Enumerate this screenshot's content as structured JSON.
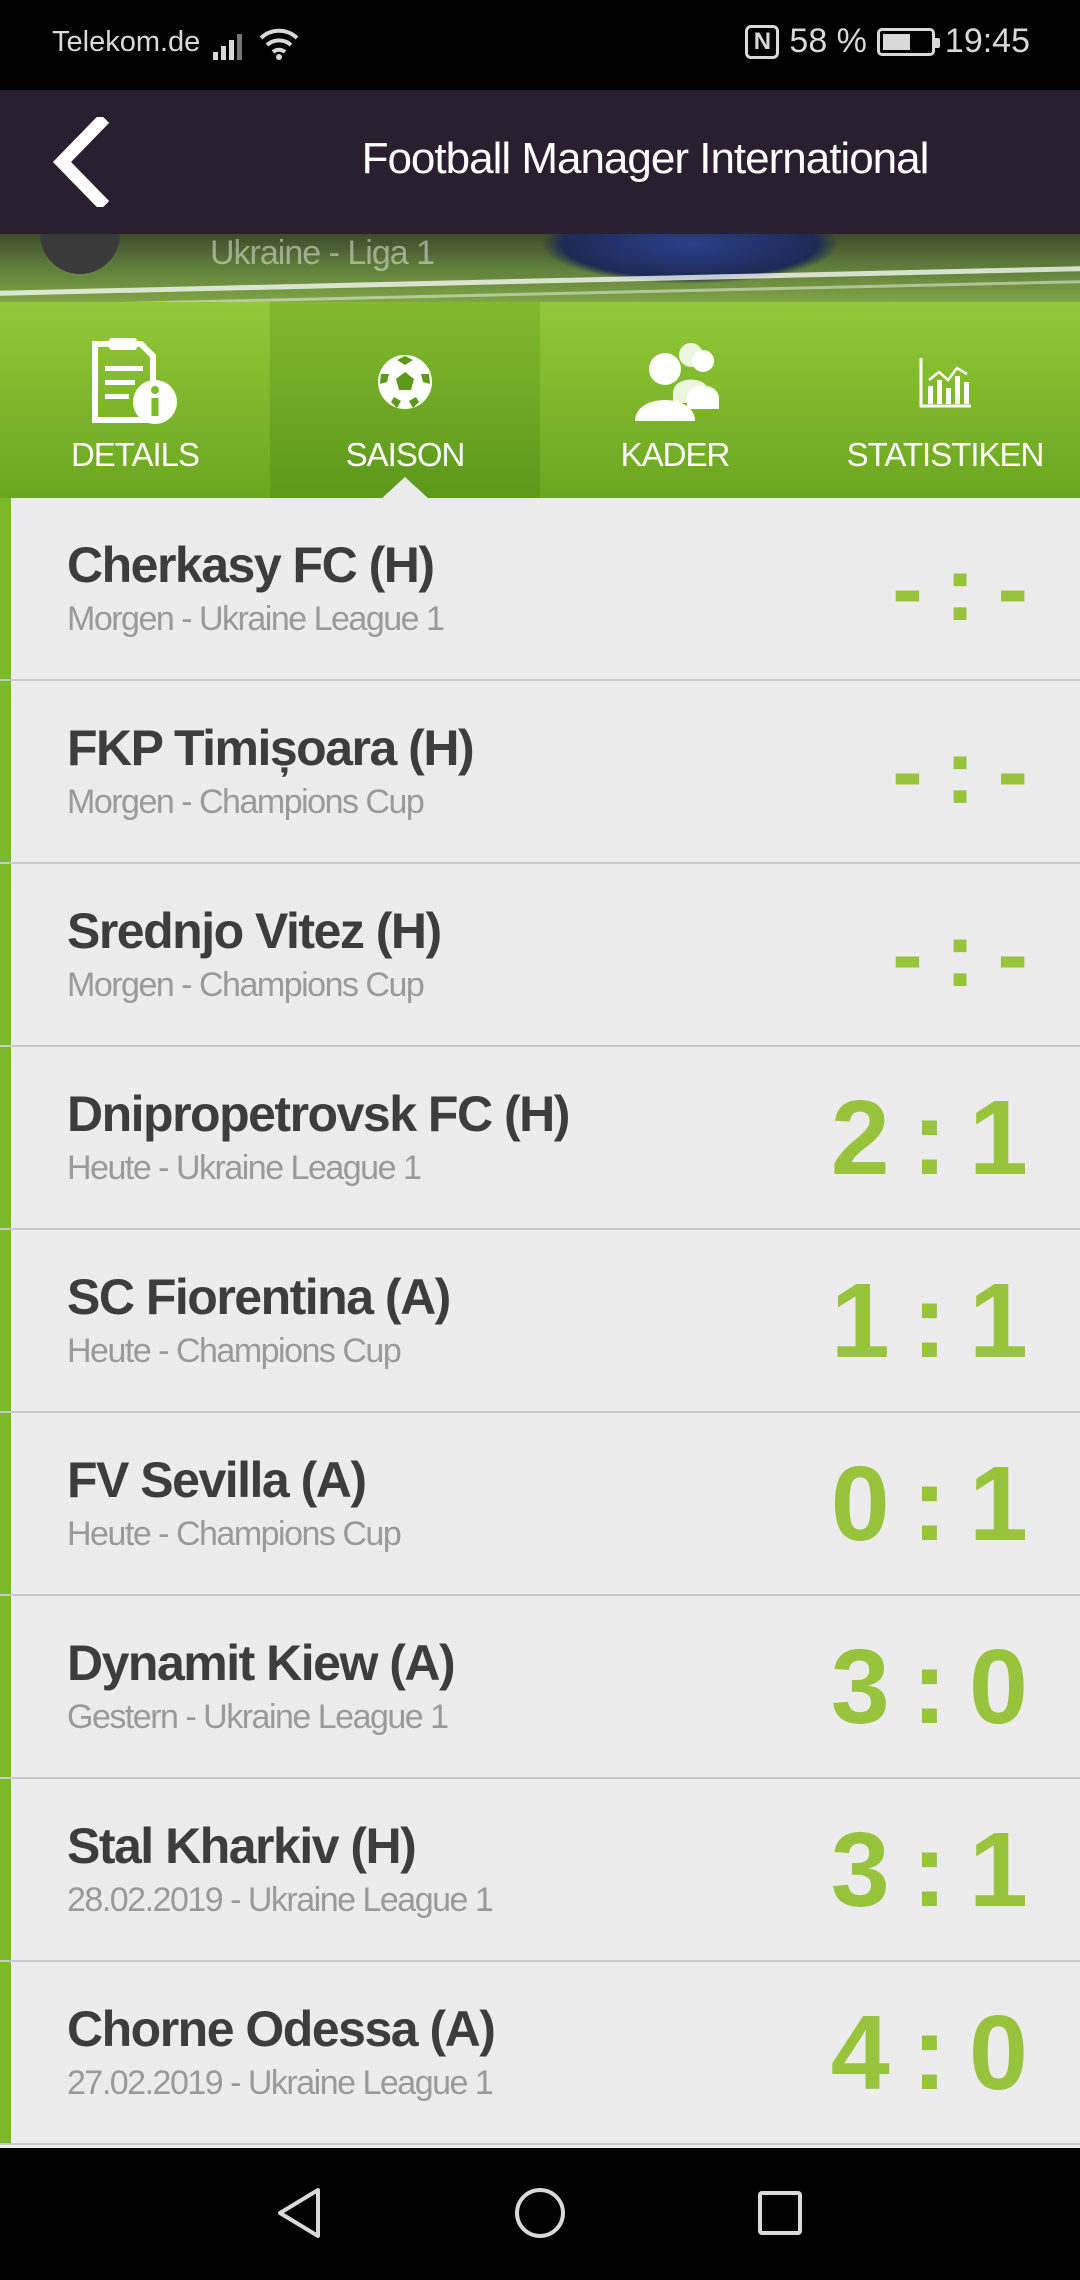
{
  "status_bar": {
    "carrier": "Telekom.de",
    "nfc_label": "N",
    "battery_text": "58 %",
    "battery_level": 0.58,
    "time": "19:45"
  },
  "app_bar": {
    "title": "Football Manager International",
    "back_icon": "chevron-left-icon"
  },
  "hero": {
    "league": "Ukraine - Liga 1"
  },
  "tabs": [
    {
      "label": "DETAILS",
      "icon": "document-info-icon",
      "active": false
    },
    {
      "label": "SAISON",
      "icon": "soccer-ball-icon",
      "active": true
    },
    {
      "label": "KADER",
      "icon": "team-people-icon",
      "active": false
    },
    {
      "label": "STATISTIKEN",
      "icon": "bar-chart-icon",
      "active": false
    }
  ],
  "matches": [
    {
      "team": "Cherkasy FC (H)",
      "meta": "Morgen - Ukraine League 1",
      "home": "-",
      "away": "-"
    },
    {
      "team": "FKP Timișoara (H)",
      "meta": "Morgen - Champions Cup",
      "home": "-",
      "away": "-"
    },
    {
      "team": "Srednjo Vitez (H)",
      "meta": "Morgen - Champions Cup",
      "home": "-",
      "away": "-"
    },
    {
      "team": "Dnipropetrovsk FC (H)",
      "meta": "Heute - Ukraine League 1",
      "home": "2",
      "away": "1"
    },
    {
      "team": "SC Fiorentina (A)",
      "meta": "Heute - Champions Cup",
      "home": "1",
      "away": "1"
    },
    {
      "team": "FV Sevilla (A)",
      "meta": "Heute - Champions Cup",
      "home": "0",
      "away": "1"
    },
    {
      "team": "Dynamit Kiew (A)",
      "meta": "Gestern - Ukraine League 1",
      "home": "3",
      "away": "0"
    },
    {
      "team": "Stal Kharkiv (H)",
      "meta": "28.02.2019 - Ukraine League 1",
      "home": "3",
      "away": "1"
    },
    {
      "team": "Chorne Odessa (A)",
      "meta": "27.02.2019 - Ukraine League 1",
      "home": "4",
      "away": "0"
    }
  ],
  "score_separator": ":",
  "colors": {
    "accent_green": "#7ab929",
    "score_green": "#98c33c",
    "app_bar": "#2a1f2f"
  },
  "nav": {
    "back_icon": "triangle-back-icon",
    "home_icon": "circle-home-icon",
    "recents_icon": "square-recents-icon"
  }
}
